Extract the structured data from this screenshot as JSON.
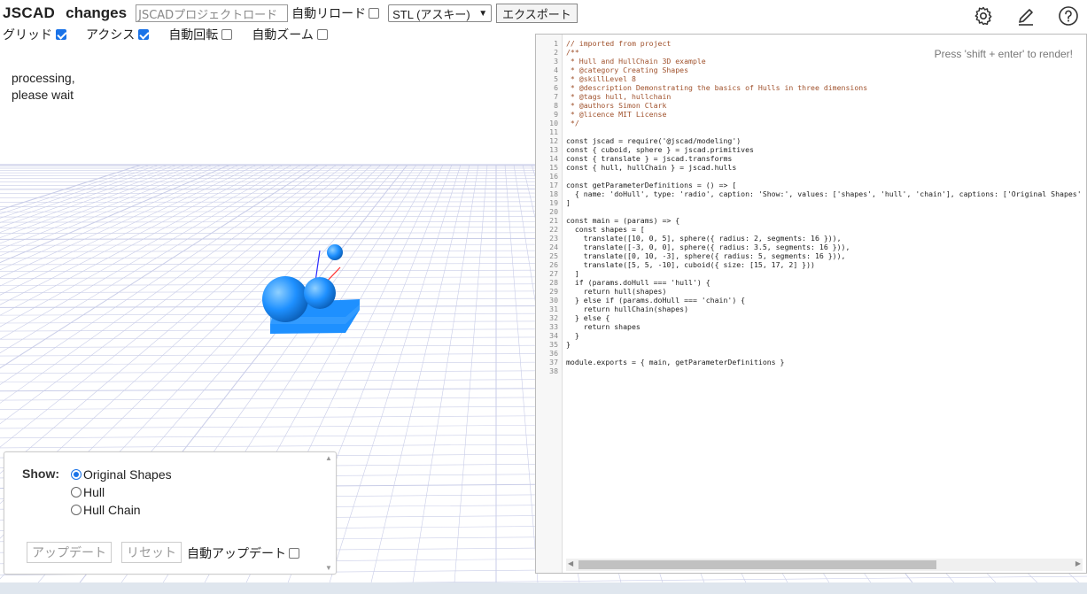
{
  "header": {
    "app_title": "JSCAD",
    "project_name": "changes",
    "load_placeholder": "JSCADプロジェクトロード",
    "auto_reload_label": "自動リロード",
    "auto_reload_checked": false,
    "format_selected": "STL (アスキー)",
    "export_label": "エクスポート"
  },
  "toggles": {
    "grid_label": "グリッド",
    "grid_checked": true,
    "axes_label": "アクシス",
    "axes_checked": true,
    "autorotate_label": "自動回転",
    "autorotate_checked": false,
    "autozoom_label": "自動ズーム",
    "autozoom_checked": false
  },
  "top_icons": [
    "gear-icon",
    "pencil-icon",
    "help-icon"
  ],
  "status": {
    "line1": "processing,",
    "line2": "please wait"
  },
  "editor": {
    "hint": "Press 'shift + enter' to render!",
    "lines": [
      "// imported from project",
      "/**",
      " * Hull and HullChain 3D example",
      " * @category Creating Shapes",
      " * @skillLevel 8",
      " * @description Demonstrating the basics of Hulls in three dimensions",
      " * @tags hull, hullchain",
      " * @authors Simon Clark",
      " * @licence MIT License",
      " */",
      "",
      "const jscad = require('@jscad/modeling')",
      "const { cuboid, sphere } = jscad.primitives",
      "const { translate } = jscad.transforms",
      "const { hull, hullChain } = jscad.hulls",
      "",
      "const getParameterDefinitions = () => [",
      "  { name: 'doHull', type: 'radio', caption: 'Show:', values: ['shapes', 'hull', 'chain'], captions: ['Original Shapes'",
      "]",
      "",
      "const main = (params) => {",
      "  const shapes = [",
      "    translate([10, 0, 5], sphere({ radius: 2, segments: 16 })),",
      "    translate([-3, 0, 0], sphere({ radius: 3.5, segments: 16 })),",
      "    translate([0, 10, -3], sphere({ radius: 5, segments: 16 })),",
      "    translate([5, 5, -10], cuboid({ size: [15, 17, 2] }))",
      "  ]",
      "  if (params.doHull === 'hull') {",
      "    return hull(shapes)",
      "  } else if (params.doHull === 'chain') {",
      "    return hullChain(shapes)",
      "  } else {",
      "    return shapes",
      "  }",
      "}",
      "",
      "module.exports = { main, getParameterDefinitions }",
      ""
    ]
  },
  "params": {
    "show_label": "Show:",
    "options": [
      {
        "label": "Original Shapes",
        "selected": true
      },
      {
        "label": "Hull",
        "selected": false
      },
      {
        "label": "Hull Chain",
        "selected": false
      }
    ],
    "update_label": "アップデート",
    "reset_label": "リセット",
    "auto_update_label": "自動アップデート",
    "auto_update_checked": false
  },
  "colors": {
    "accent": "#1a73e8",
    "shape_blue": "#1e90ff",
    "grid_line": "#c9cde8"
  }
}
